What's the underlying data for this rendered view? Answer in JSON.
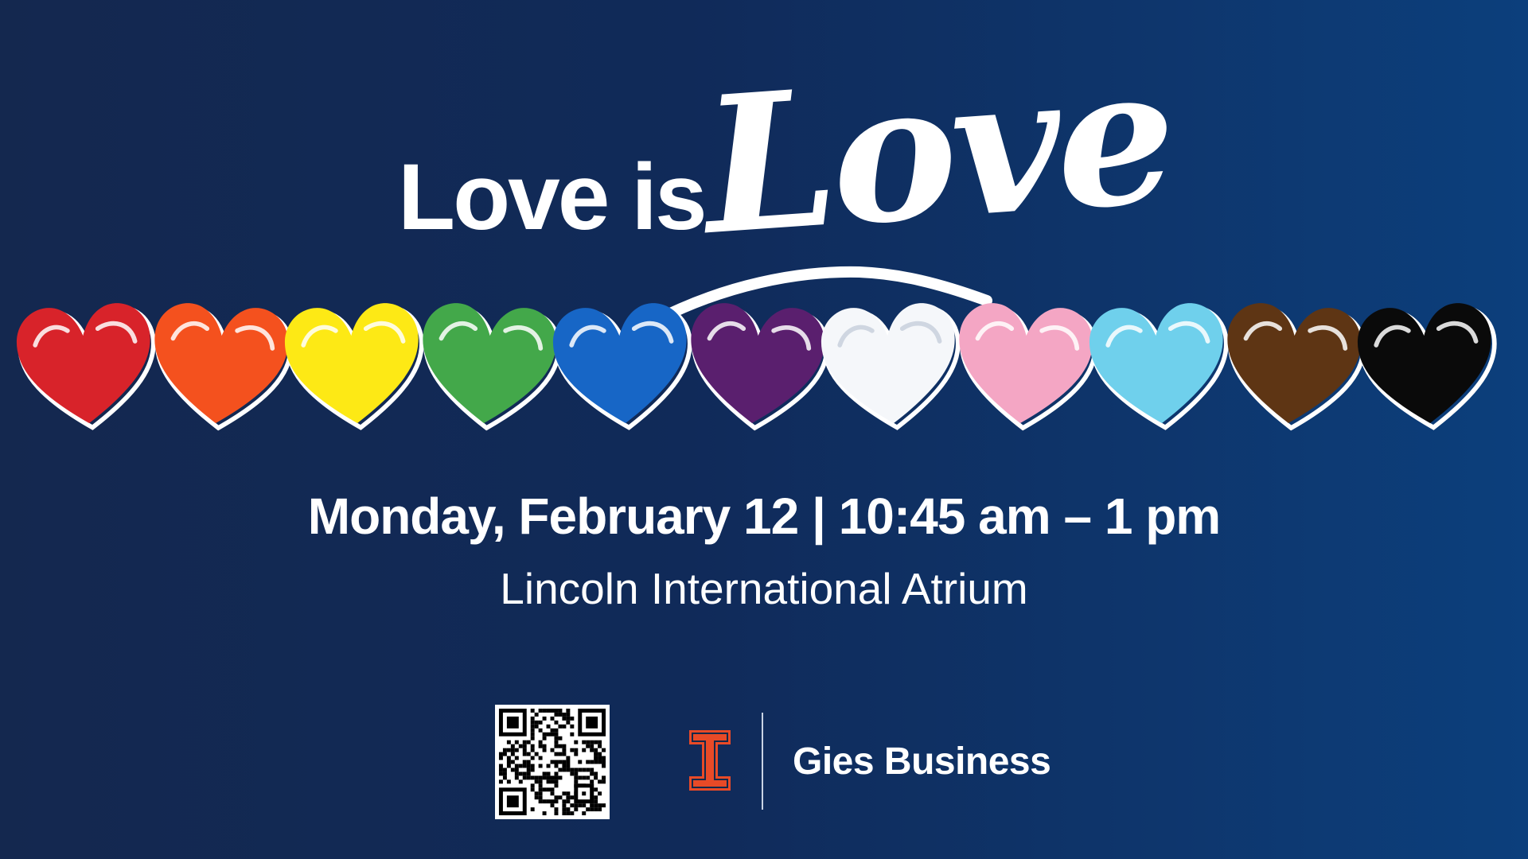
{
  "headline": {
    "plain": "Love is",
    "script": "Love"
  },
  "hearts": [
    {
      "color": "#d8232a"
    },
    {
      "color": "#f4511e"
    },
    {
      "color": "#fde915"
    },
    {
      "color": "#43a84a"
    },
    {
      "color": "#1766c6"
    },
    {
      "color": "#5a1f6e"
    },
    {
      "color": "#f5f7fa"
    },
    {
      "color": "#f4a6c4"
    },
    {
      "color": "#6fd0ec"
    },
    {
      "color": "#5e3514"
    },
    {
      "color": "#0a0a0a"
    }
  ],
  "event": {
    "datetime": "Monday, February 12 | 10:45 am – 1 pm",
    "location": "Lincoln International Atrium"
  },
  "footer": {
    "qr_icon": "qr-code",
    "logo_icon": "illinois-block-i",
    "logo_color": "#e84a27",
    "brand": "Gies Business"
  }
}
